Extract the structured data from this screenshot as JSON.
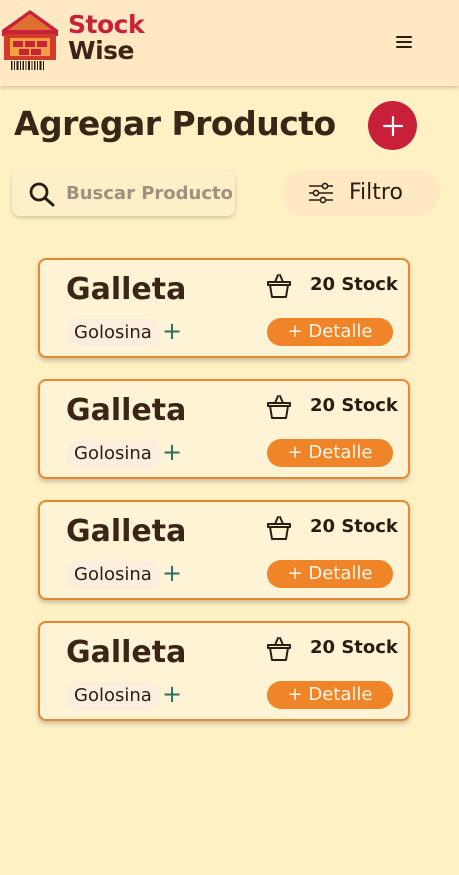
{
  "brand": {
    "line1": "Stock",
    "line2": "Wise"
  },
  "page": {
    "title": "Agregar Producto"
  },
  "search": {
    "placeholder": "Buscar Productos",
    "value": ""
  },
  "filter": {
    "label": "Filtro"
  },
  "colors": {
    "accent_red": "#c8203a",
    "accent_orange": "#f08428",
    "background": "#fff1c4",
    "header": "#ffe8c2"
  },
  "icons": {
    "logo": "warehouse-logo",
    "menu": "hamburger-icon",
    "add": "plus-icon",
    "search": "search-icon",
    "filter": "sliders-icon",
    "stock": "basket-icon"
  },
  "products": [
    {
      "name": "Galleta",
      "stock": "20 Stock",
      "category": "Golosina",
      "detail": "+ Detalle"
    },
    {
      "name": "Galleta",
      "stock": "20 Stock",
      "category": "Golosina",
      "detail": "+ Detalle"
    },
    {
      "name": "Galleta",
      "stock": "20 Stock",
      "category": "Golosina",
      "detail": "+ Detalle"
    },
    {
      "name": "Galleta",
      "stock": "20 Stock",
      "category": "Golosina",
      "detail": "+ Detalle"
    }
  ],
  "category_add": "+"
}
